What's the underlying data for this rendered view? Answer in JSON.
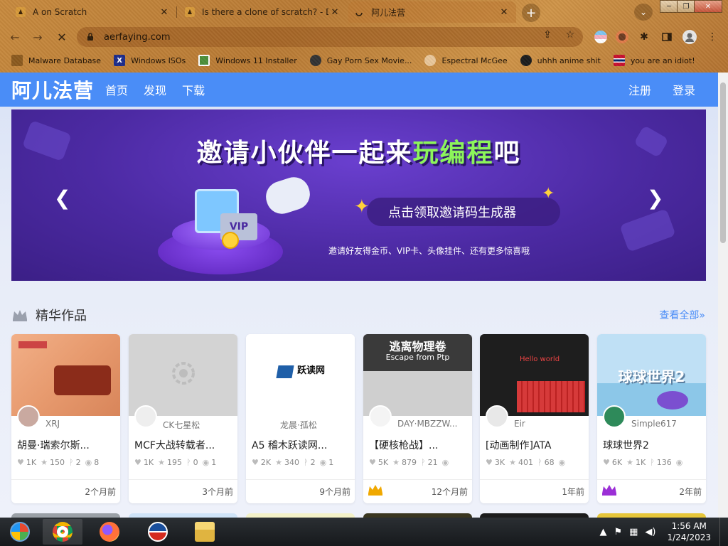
{
  "browser": {
    "tabs": [
      {
        "title": "A on Scratch",
        "active": false
      },
      {
        "title": "Is there a clone of scratch? - Dis",
        "active": false
      },
      {
        "title": "阿儿法营",
        "active": true
      }
    ],
    "url": "aerfaying.com",
    "bookmarks": [
      {
        "label": "Malware Database"
      },
      {
        "label": "Windows ISOs"
      },
      {
        "label": "Windows 11 Installer"
      },
      {
        "label": "Gay Porn Sex Movie..."
      },
      {
        "label": "Espectral McGee"
      },
      {
        "label": "uhhh anime shit"
      },
      {
        "label": "you are an idiot!"
      }
    ],
    "close_glyph": "✕",
    "newtab_glyph": "+",
    "back_glyph": "←",
    "forward_glyph": "→",
    "stop_glyph": "✕",
    "menu_glyph": "⋮",
    "share_glyph": "⇪",
    "star_glyph": "☆",
    "puzzle_glyph": "✱",
    "tabsearch_glyph": "⌄",
    "minimize_glyph": "─",
    "restore_glyph": "❐",
    "close_window_glyph": "✕",
    "x_glyph": "X"
  },
  "site": {
    "logo": "阿儿法营",
    "nav": [
      "首页",
      "发现",
      "下载"
    ],
    "nav_right": [
      "注册",
      "登录"
    ],
    "accent": "#4a8df7",
    "banner": {
      "headline_a": "邀请小伙伴一起来",
      "headline_b": "玩编程",
      "headline_c": "吧",
      "button": "点击领取邀请码生成器",
      "subtitle": "邀请好友得金币、VIP卡、头像挂件、还有更多惊喜哦",
      "vip": "VIP",
      "prev_glyph": "❮",
      "next_glyph": "❯",
      "star_glyph": "✦"
    },
    "section": {
      "title": "精华作品",
      "view_all": "查看全部»"
    },
    "stat_icons": {
      "like": "♥",
      "star": "★",
      "fork": "ᚹ",
      "view": "◉"
    },
    "cards": [
      {
        "author": "XRJ",
        "title": "胡曼·瑞索尔斯...",
        "likes": "1K",
        "stars": "150",
        "forks": "2",
        "views": "8",
        "time": "2个月前",
        "badge": false
      },
      {
        "author": "CK七星松",
        "title": "MCF大战转载者...",
        "likes": "1K",
        "stars": "195",
        "forks": "0",
        "views": "1",
        "time": "3个月前",
        "badge": false
      },
      {
        "author": "龙晨·孤松",
        "title": "A5 稽木跃读网...",
        "likes": "2K",
        "stars": "340",
        "forks": "2",
        "views": "1",
        "time": "9个月前",
        "badge": false,
        "thumb_label": "跃读网"
      },
      {
        "author": "DAY·MBZZW...",
        "title": "【硬核枪战】...",
        "likes": "5K",
        "stars": "879",
        "forks": "21",
        "views": "",
        "time": "12个月前",
        "badge": true,
        "badge_color": "#f0a800",
        "thumb_label": "逃离物理卷",
        "thumb_sub": "Escape from Ptp"
      },
      {
        "author": "Eir",
        "title": "[动画制作]ATA",
        "likes": "3K",
        "stars": "401",
        "forks": "68",
        "views": "",
        "time": "1年前",
        "badge": false,
        "thumb_label": "Hello world"
      },
      {
        "author": "Simple617",
        "title": "球球世界2",
        "likes": "6K",
        "stars": "1K",
        "forks": "136",
        "views": "",
        "time": "2年前",
        "badge": true,
        "badge_color": "#9b2fd6",
        "thumb_label": "球球世界2"
      }
    ]
  },
  "taskbar": {
    "time": "1:56 AM",
    "date": "1/24/2023",
    "tray_up": "▲",
    "tray_flag": "⚑",
    "tray_net": "▦",
    "tray_vol": "◀)"
  }
}
